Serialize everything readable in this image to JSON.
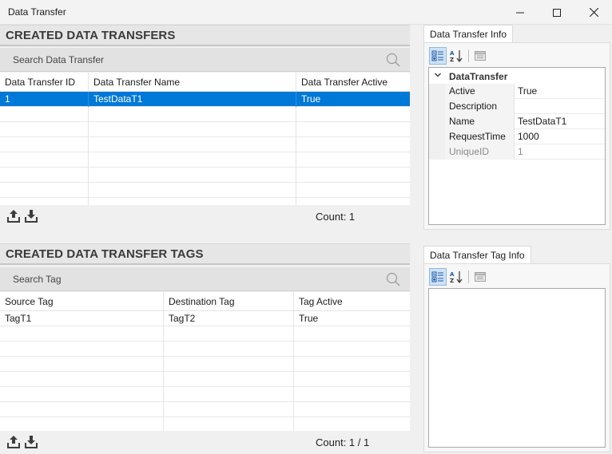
{
  "window": {
    "title": "Data Transfer"
  },
  "transfers": {
    "header": "CREATED DATA TRANSFERS",
    "search_placeholder": "Search Data Transfer",
    "columns": [
      "Data Transfer ID",
      "Data Transfer Name",
      "Data Transfer Active"
    ],
    "rows": [
      {
        "id": "1",
        "name": "TestDataT1",
        "active": "True",
        "selected": true
      }
    ],
    "count": "Count: 1"
  },
  "tags": {
    "header": "CREATED DATA TRANSFER TAGS",
    "search_placeholder": "Search Tag",
    "columns": [
      "Source Tag",
      "Destination Tag",
      "Tag Active"
    ],
    "rows": [
      {
        "source": "TagT1",
        "destination": "TagT2",
        "active": "True"
      }
    ],
    "count": "Count: 1 / 1"
  },
  "transfer_info": {
    "tab": "Data Transfer Info",
    "category": "DataTransfer",
    "properties": [
      {
        "key": "Active",
        "value": "True",
        "readonly": false
      },
      {
        "key": "Description",
        "value": "",
        "readonly": false
      },
      {
        "key": "Name",
        "value": "TestDataT1",
        "readonly": false
      },
      {
        "key": "RequestTime",
        "value": "1000",
        "readonly": false
      },
      {
        "key": "UniqueID",
        "value": "1",
        "readonly": true
      }
    ]
  },
  "tag_info": {
    "tab": "Data Transfer Tag Info"
  },
  "colors": {
    "selection": "#0078d7",
    "toolbar_active": "#cfe3f7"
  }
}
